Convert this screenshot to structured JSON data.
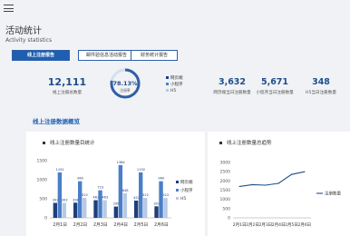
{
  "header": {
    "title": "活动统计",
    "subtitle": "Activity statistics"
  },
  "tabs": [
    {
      "label": "线上注册报告",
      "active": true
    },
    {
      "label": "邮件验信息活动报告",
      "active": false
    },
    {
      "label": "财务统计报告",
      "active": false
    }
  ],
  "summary": {
    "total_value": "12,111",
    "total_label": "线上注册总数量",
    "ring_percent": "78.13%",
    "ring_label": "注册率",
    "ring_fraction": 0.7813,
    "legend": [
      {
        "label": "网页端",
        "color": "#1f3e7a"
      },
      {
        "label": "小程序",
        "color": "#4a7fc8"
      },
      {
        "label": "H5",
        "color": "#b8c9e6"
      }
    ],
    "stats": [
      {
        "value": "3,632",
        "label": "网页端当日注册数量"
      },
      {
        "value": "5,671",
        "label": "小程序当日注册数量"
      },
      {
        "value": "348",
        "label": "H5当日注册数量"
      }
    ]
  },
  "section_title": "线上注册数据概览",
  "bar_card": {
    "title": "线上注册数量目统计"
  },
  "line_card": {
    "title": "线上注册数量总趋势"
  },
  "chart_data": [
    {
      "type": "bar",
      "title": "线上注册数量目统计",
      "categories": [
        "2月1日",
        "2月2日",
        "2月3日",
        "2月4日",
        "2月5日",
        "2月6日"
      ],
      "ylim": [
        0,
        1500
      ],
      "yticks": [
        "0",
        "500",
        "1000",
        "1500"
      ],
      "series": [
        {
          "name": "网页端",
          "color": "#1f3e7a",
          "values": [
            393,
            398,
            463,
            296,
            452,
            302
          ]
        },
        {
          "name": "小程序",
          "color": "#4a7fc8",
          "values": [
            1192,
            960,
            723,
            1384,
            1192,
            960
          ]
        },
        {
          "name": "H5",
          "color": "#b8c9e6",
          "values": [
            393,
            522,
            463,
            648,
            522,
            522
          ]
        }
      ]
    },
    {
      "type": "line",
      "title": "线上注册数量总趋势",
      "x": [
        "2月1日",
        "2月2日",
        "2月3日",
        "2月4日",
        "2月5日",
        "2月6日"
      ],
      "ylim": [
        0,
        3000
      ],
      "yticks": [
        "0",
        "500",
        "1000",
        "1500",
        "2000",
        "2500",
        "3000"
      ],
      "series": [
        {
          "name": "注册数量",
          "color": "#1f4e8c",
          "values": [
            1700,
            1800,
            1770,
            1870,
            2350,
            2500
          ]
        }
      ]
    }
  ]
}
